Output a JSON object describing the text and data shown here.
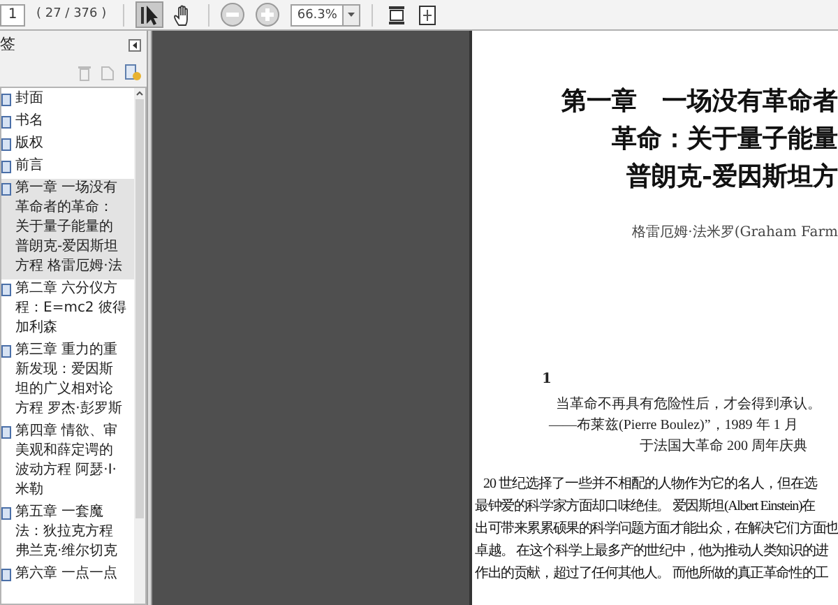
{
  "toolbar": {
    "page_field": {
      "value": "1"
    },
    "page_count": "( 27 / 376 )",
    "tools": [
      {
        "kind": "select",
        "selected": true
      },
      {
        "kind": "hand",
        "selected": false
      }
    ],
    "zoom_field": {
      "value": "66.3%"
    }
  },
  "bookmarks": {
    "title": "签",
    "items": [
      {
        "lines": [
          "封面"
        ],
        "selected": false
      },
      {
        "lines": [
          "书名"
        ],
        "selected": false
      },
      {
        "lines": [
          "版权"
        ],
        "selected": false
      },
      {
        "lines": [
          "前言"
        ],
        "selected": false
      },
      {
        "lines": [
          "第一章 一场没有",
          "革命者的革命：",
          "关于量子能量的",
          "普朗克-爱因斯坦",
          "方程 格雷厄姆·法"
        ],
        "selected": true
      },
      {
        "lines": [
          "第二章 六分仪方",
          "程：E=mc2 彼得",
          "加利森"
        ],
        "selected": false
      },
      {
        "lines": [
          "第三章 重力的重",
          "新发现：爱因斯",
          "坦的广义相对论",
          "方程 罗杰·彭罗斯"
        ],
        "selected": false
      },
      {
        "lines": [
          "第四章 情欲、审",
          "美观和薛定谔的",
          "波动方程 阿瑟·I·",
          "米勒"
        ],
        "selected": false
      },
      {
        "lines": [
          "第五章 一套魔",
          "法：狄拉克方程",
          "弗兰克·维尔切克"
        ],
        "selected": false
      },
      {
        "lines": [
          "第六章 一点一点"
        ],
        "selected": false
      }
    ]
  },
  "page": {
    "title_lines": [
      "第一章　一场没有革命者",
      "革命：关于量子能量",
      "普朗克-爱因斯坦方"
    ],
    "author": "格雷厄姆·法米罗(Graham Farm",
    "page_number": "1",
    "epigraph": [
      "当革命不再具有危险性后，才会得到承认。",
      "——布莱兹(Pierre Boulez)”，1989 年 1 月",
      "于法国大革命 200 周年庆典"
    ],
    "body_lines": [
      "20 世纪选择了一些并不相配的人物作为它的名人，但在选",
      "最钟爱的科学家方面却口味绝佳。 爱因斯坦(Albert Einstein)在",
      "出可带来累累硕果的科学问题方面才能出众，在解决它们方面也",
      "卓越。 在这个科学上最多产的世纪中，他为推动人类知识的进",
      "作出的贡献，超过了任何其他人。 而他所做的真正革命性的工"
    ]
  }
}
